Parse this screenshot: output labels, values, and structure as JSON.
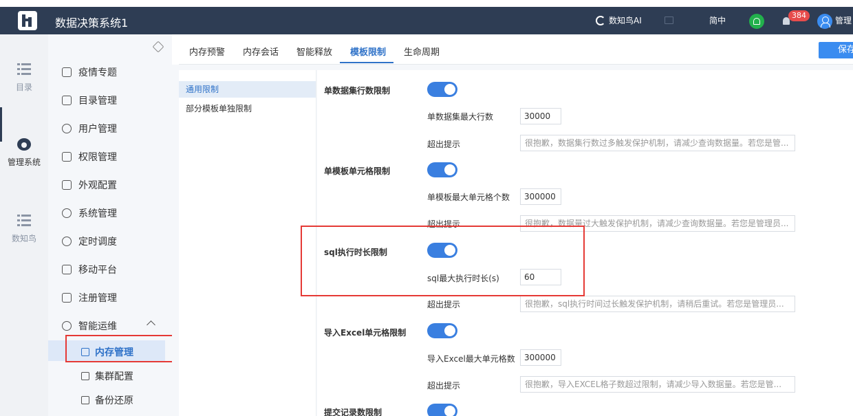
{
  "header": {
    "app_title": "数据决策系统1",
    "ai_label": "数知鸟AI",
    "lang": "简中",
    "notify_count": "384",
    "user": "管理"
  },
  "rail": {
    "items": [
      {
        "label": "目录",
        "icon": "list-icon"
      },
      {
        "label": "管理系统",
        "icon": "gear-icon"
      },
      {
        "label": "数知鸟",
        "icon": "list-icon"
      }
    ]
  },
  "sidebar": {
    "items": [
      {
        "label": "疫情专题",
        "icon": "badge-icon"
      },
      {
        "label": "目录管理",
        "icon": "catalog-icon"
      },
      {
        "label": "用户管理",
        "icon": "user-icon"
      },
      {
        "label": "权限管理",
        "icon": "lock-icon"
      },
      {
        "label": "外观配置",
        "icon": "brush-icon"
      },
      {
        "label": "系统管理",
        "icon": "settings-icon"
      },
      {
        "label": "定时调度",
        "icon": "timer-icon"
      },
      {
        "label": "移动平台",
        "icon": "mobile-icon"
      },
      {
        "label": "注册管理",
        "icon": "register-icon"
      },
      {
        "label": "智能运维",
        "icon": "ops-icon"
      }
    ],
    "sub_items": [
      {
        "label": "内存管理",
        "icon": "memory-icon"
      },
      {
        "label": "集群配置",
        "icon": "cluster-icon"
      },
      {
        "label": "备份还原",
        "icon": "backup-icon"
      }
    ]
  },
  "tabs": [
    "内存预警",
    "内存会话",
    "智能释放",
    "模板限制",
    "生命周期"
  ],
  "save_label": "保存",
  "subnav": [
    "通用限制",
    "部分模板单独限制"
  ],
  "sections": {
    "s1": {
      "title": "单数据集行数限制",
      "field_label": "单数据集最大行数",
      "value": "30000",
      "msg_label": "超出提示",
      "msg": "很抱歉，数据集行数过多触发保护机制，请减少查询数据量。若您是管..."
    },
    "s2": {
      "title": "单模板单元格限制",
      "field_label": "单模板最大单元格个数",
      "value": "300000",
      "msg_label": "超出提示",
      "msg": "很抱歉，数据量过大触发保护机制，请减少查询数据量。若您是管理员..."
    },
    "s3": {
      "title": "sql执行时长限制",
      "field_label": "sql最大执行时长(s)",
      "value": "60",
      "msg_label": "超出提示",
      "msg": "很抱歉，sql执行时间过长触发保护机制，请稍后重试。若您是管理员..."
    },
    "s4": {
      "title": "导入Excel单元格限制",
      "field_label": "导入Excel最大单元格数",
      "value": "300000",
      "msg_label": "超出提示",
      "msg": "很抱歉，导入EXCEL格子数超过限制，请减少导入数据量。若您是管..."
    },
    "s5": {
      "title": "提交记录数限制"
    }
  }
}
